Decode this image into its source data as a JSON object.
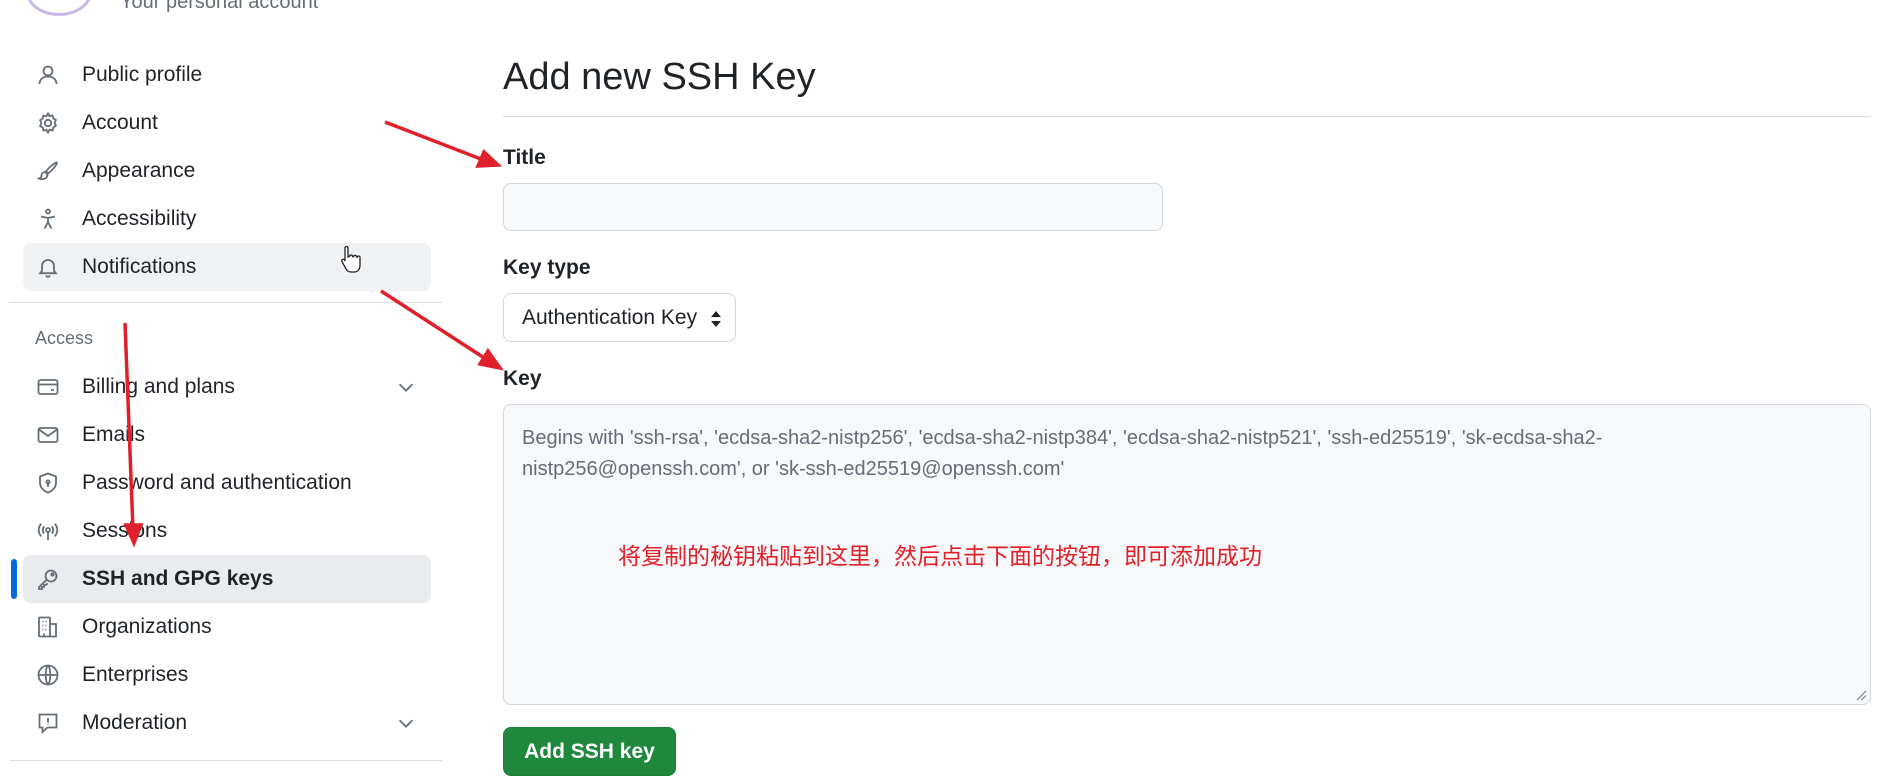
{
  "account": {
    "subtitle": "Your personal account"
  },
  "sidebar": {
    "items": [
      {
        "label": "Public profile",
        "icon": "person-icon"
      },
      {
        "label": "Account",
        "icon": "gear-icon"
      },
      {
        "label": "Appearance",
        "icon": "paintbrush-icon"
      },
      {
        "label": "Accessibility",
        "icon": "accessibility-icon"
      },
      {
        "label": "Notifications",
        "icon": "bell-icon"
      }
    ],
    "access_heading": "Access",
    "access_items": [
      {
        "label": "Billing and plans",
        "icon": "credit-card-icon"
      },
      {
        "label": "Emails",
        "icon": "mail-icon"
      },
      {
        "label": "Password and authentication",
        "icon": "shield-icon"
      },
      {
        "label": "Sessions",
        "icon": "broadcast-icon"
      },
      {
        "label": "SSH and GPG keys",
        "icon": "key-icon"
      },
      {
        "label": "Organizations",
        "icon": "organization-icon"
      },
      {
        "label": "Enterprises",
        "icon": "globe-icon"
      },
      {
        "label": "Moderation",
        "icon": "report-icon"
      }
    ]
  },
  "main": {
    "title": "Add new SSH Key",
    "title_label": "Title",
    "title_value": "",
    "key_type_label": "Key type",
    "key_type_value": "Authentication Key",
    "key_label": "Key",
    "key_placeholder": "Begins with 'ssh-rsa', 'ecdsa-sha2-nistp256', 'ecdsa-sha2-nistp384', 'ecdsa-sha2-nistp521', 'ssh-ed25519', 'sk-ecdsa-sha2-nistp256@openssh.com', or 'sk-ssh-ed25519@openssh.com'",
    "annotation": "将复制的秘钥粘贴到这里，然后点击下面的按钮，即可添加成功",
    "submit_label": "Add SSH key"
  },
  "colors": {
    "accent": "#0969da",
    "primary_button": "#1f883d",
    "annotation": "#e0202a"
  }
}
